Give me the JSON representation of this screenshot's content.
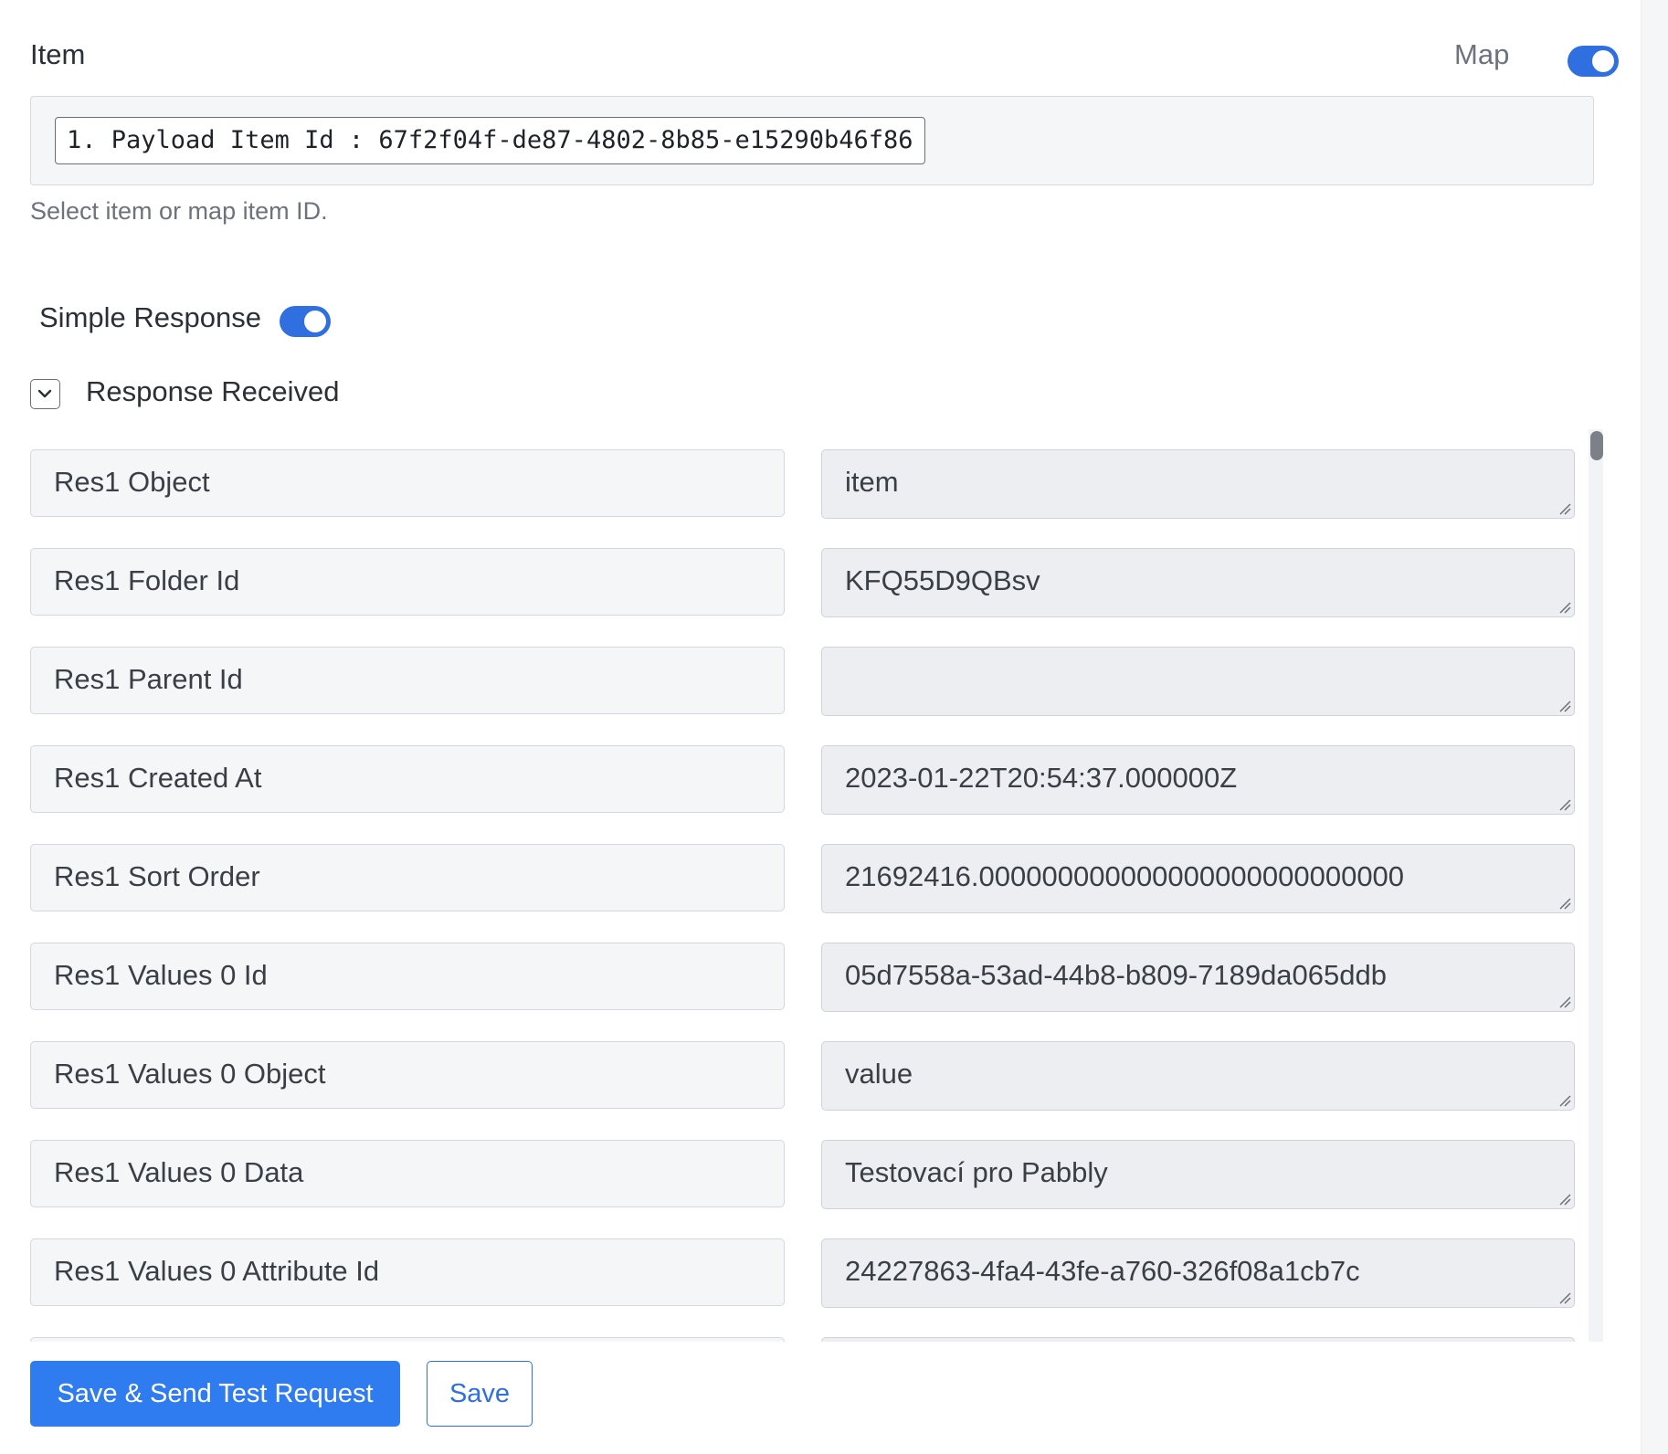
{
  "item_section": {
    "label": "Item",
    "map_label": "Map",
    "map_toggle_on": true,
    "selected_item": "1. Payload Item Id : 67f2f04f-de87-4802-8b85-e15290b46f86",
    "helper_text": "Select item or map item ID."
  },
  "simple_response": {
    "label": "Simple Response",
    "toggle_on": true
  },
  "response_received": {
    "label": "Response Received",
    "expanded": true
  },
  "response_rows": [
    {
      "key": "Res1 Object",
      "value": "item"
    },
    {
      "key": "Res1 Folder Id",
      "value": "KFQ55D9QBsv"
    },
    {
      "key": "Res1 Parent Id",
      "value": ""
    },
    {
      "key": "Res1 Created At",
      "value": "2023-01-22T20:54:37.000000Z"
    },
    {
      "key": "Res1 Sort Order",
      "value": "21692416.000000000000000000000000000"
    },
    {
      "key": "Res1 Values 0 Id",
      "value": "05d7558a-53ad-44b8-b809-7189da065ddb"
    },
    {
      "key": "Res1 Values 0 Object",
      "value": "value"
    },
    {
      "key": "Res1 Values 0 Data",
      "value": "Testovací pro Pabbly"
    },
    {
      "key": "Res1 Values 0 Attribute Id",
      "value": "24227863-4fa4-43fe-a760-326f08a1cb7c"
    },
    {
      "key": "",
      "value": ""
    }
  ],
  "buttons": {
    "save_send_label": "Save & Send Test Request",
    "save_label": "Save"
  },
  "colors": {
    "accent": "#2f6fe0",
    "primary_button": "#2f7bf0",
    "field_bg": "#f5f6f8",
    "value_bg": "#eceef1"
  },
  "icons": {
    "collapse": "chevron-down-icon",
    "resize": "resize-grip-icon"
  }
}
